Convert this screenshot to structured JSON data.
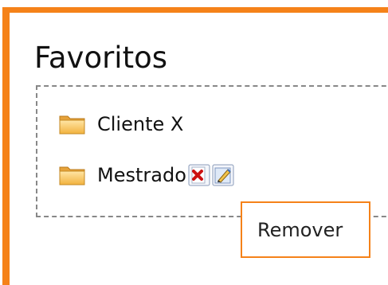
{
  "page": {
    "accent_color": "#f58219"
  },
  "favorites": {
    "title": "Favoritos",
    "items": [
      {
        "label": "Cliente X",
        "icon": "folder-icon"
      },
      {
        "label": "Mestrado",
        "icon": "folder-icon",
        "actions": [
          {
            "icon": "delete-icon",
            "color": "#cc1111"
          },
          {
            "icon": "edit-icon",
            "color": "#3a6fc2"
          }
        ]
      }
    ]
  },
  "tooltip": {
    "text": "Remover"
  }
}
